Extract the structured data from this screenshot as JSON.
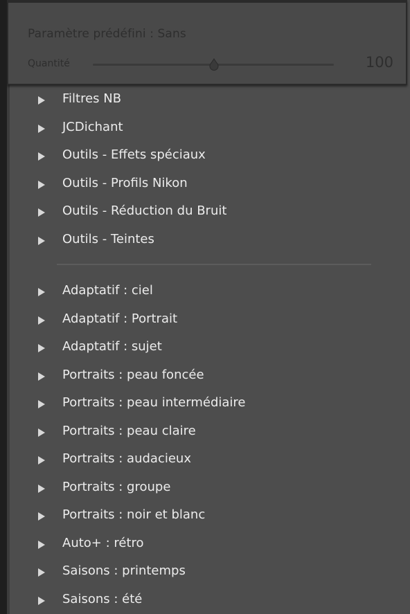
{
  "header": {
    "preset_label": "Paramètre prédéfini : Sans",
    "amount_label": "Quantité",
    "amount_value": "100",
    "slider_value_fraction": 0.5
  },
  "group1": [
    {
      "label": "Filtres NB",
      "icon": "expand-arrow-icon"
    },
    {
      "label": "JCDichant",
      "icon": "expand-arrow-icon"
    },
    {
      "label": "Outils - Effets spéciaux",
      "icon": "expand-arrow-icon"
    },
    {
      "label": "Outils - Profils Nikon",
      "icon": "expand-arrow-icon"
    },
    {
      "label": "Outils - Réduction du Bruit",
      "icon": "expand-arrow-icon"
    },
    {
      "label": "Outils - Teintes",
      "icon": "expand-arrow-icon"
    }
  ],
  "group2": [
    {
      "label": "Adaptatif : ciel",
      "icon": "expand-arrow-icon"
    },
    {
      "label": "Adaptatif : Portrait",
      "icon": "expand-arrow-icon"
    },
    {
      "label": "Adaptatif : sujet",
      "icon": "expand-arrow-icon"
    },
    {
      "label": "Portraits : peau foncée",
      "icon": "expand-arrow-icon"
    },
    {
      "label": "Portraits : peau intermédiaire",
      "icon": "expand-arrow-icon"
    },
    {
      "label": "Portraits : peau claire",
      "icon": "expand-arrow-icon"
    },
    {
      "label": "Portraits : audacieux",
      "icon": "expand-arrow-icon"
    },
    {
      "label": "Portraits : groupe",
      "icon": "expand-arrow-icon"
    },
    {
      "label": "Portraits : noir et blanc",
      "icon": "expand-arrow-icon"
    },
    {
      "label": "Auto+ : rétro",
      "icon": "expand-arrow-icon"
    },
    {
      "label": "Saisons : printemps",
      "icon": "expand-arrow-icon"
    },
    {
      "label": "Saisons : été",
      "icon": "expand-arrow-icon"
    }
  ],
  "colors": {
    "panel_bg": "#4d4d4d",
    "header_bg": "#494949",
    "item_text": "#ececec",
    "arrow": "#d8d8d8"
  }
}
